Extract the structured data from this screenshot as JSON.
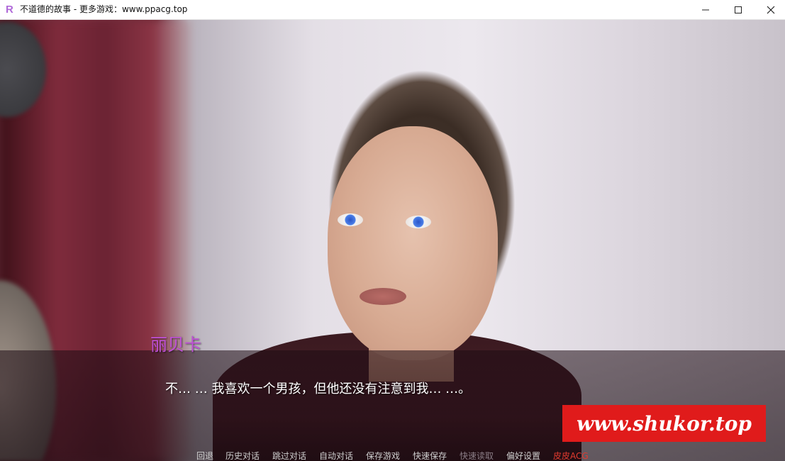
{
  "window": {
    "title": "不道德的故事 - 更多游戏：www.ppacg.top",
    "app_icon_glyph": "R",
    "controls": {
      "minimize": "minimize-icon",
      "maximize": "maximize-icon",
      "close": "close-icon"
    }
  },
  "dialogue": {
    "speaker": "丽贝卡",
    "text": "不… … 我喜欢一个男孩，但他还没有注意到我… …。",
    "speaker_color": "#c050d8"
  },
  "watermark": {
    "text": "www.shukor.top",
    "color": "#e01b1b"
  },
  "quick_menu": [
    {
      "label": "回退",
      "state": "normal"
    },
    {
      "label": "历史对话",
      "state": "normal"
    },
    {
      "label": "跳过对话",
      "state": "normal"
    },
    {
      "label": "自动对话",
      "state": "normal"
    },
    {
      "label": "保存游戏",
      "state": "normal"
    },
    {
      "label": "快速保存",
      "state": "normal"
    },
    {
      "label": "快速读取",
      "state": "disabled"
    },
    {
      "label": "偏好设置",
      "state": "normal"
    },
    {
      "label": "皮皮ACG",
      "state": "accent"
    }
  ]
}
